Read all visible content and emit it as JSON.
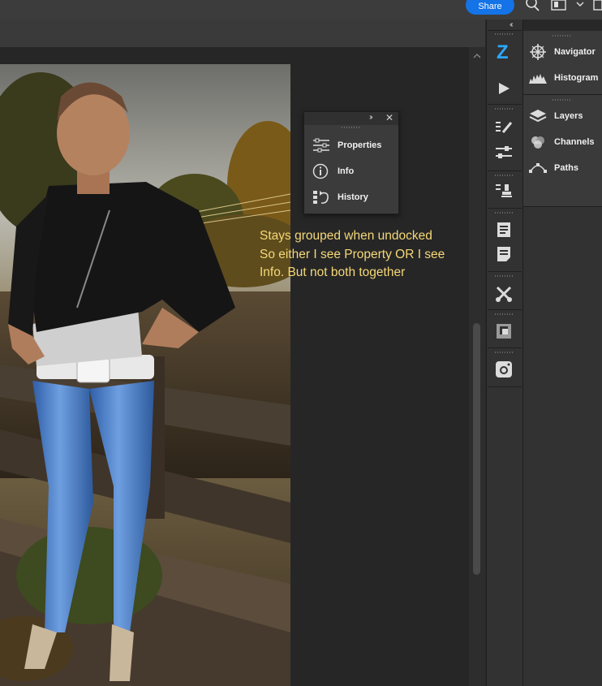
{
  "header": {
    "share_label": "Share",
    "icons": [
      "search-icon",
      "workspace-icon",
      "chevron-down-icon",
      "arrange-icon"
    ]
  },
  "toolbar_icons": [
    "zoom-plugin-icon",
    "play-icon",
    "brush-settings-icon",
    "adjustments-icon",
    "clone-source-icon",
    "notes-icon",
    "paragraph-icon",
    "tool-presets-icon",
    "libraries-icon",
    "camera-icon"
  ],
  "right_panel": {
    "group1": [
      {
        "label": "Navigator",
        "icon": "navigator-icon"
      },
      {
        "label": "Histogram",
        "icon": "histogram-icon"
      }
    ],
    "group2": [
      {
        "label": "Layers",
        "icon": "layers-icon"
      },
      {
        "label": "Channels",
        "icon": "channels-icon"
      },
      {
        "label": "Paths",
        "icon": "paths-icon"
      }
    ]
  },
  "floating_panel": {
    "items": [
      {
        "label": "Properties",
        "icon": "properties-icon"
      },
      {
        "label": "Info",
        "icon": "info-icon"
      },
      {
        "label": "History",
        "icon": "history-icon"
      }
    ]
  },
  "annotation": {
    "lines": [
      "Stays grouped when undocked",
      "So either I see Property OR I see",
      "Info. But not both together"
    ]
  },
  "colors": {
    "share": "#1473e6",
    "annotation": "#f5d878",
    "zoom_icon": "#2aa8ff"
  }
}
